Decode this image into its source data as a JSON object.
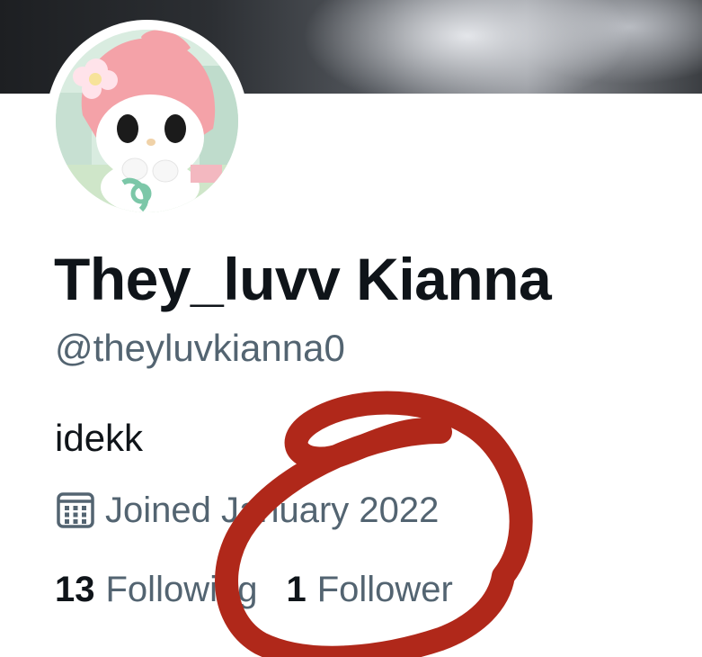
{
  "profile": {
    "display_name": "They_luvv Kianna",
    "handle": "@theyluvkianna0",
    "bio": "idekk",
    "joined": "Joined January 2022"
  },
  "stats": {
    "following_count": "13",
    "following_label": "Following",
    "followers_count": "1",
    "followers_label": "Follower"
  },
  "icons": {
    "calendar": "calendar-icon"
  },
  "colors": {
    "primary_text": "#0f1419",
    "secondary_text": "#536471",
    "annotation_red": "#b0281a"
  }
}
